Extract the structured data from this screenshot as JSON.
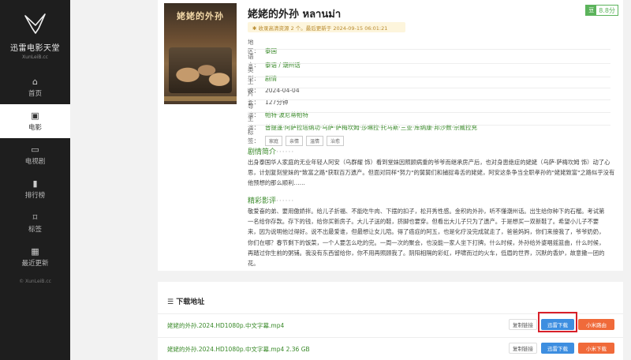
{
  "sidebar": {
    "logo_name": "迅雷电影天堂",
    "logo_url": "XunLeiB.cc",
    "items": [
      {
        "icon": "home-icon",
        "glyph": "⌂",
        "label": "首页"
      },
      {
        "icon": "film-icon",
        "glyph": "▣",
        "label": "电影",
        "active": true
      },
      {
        "icon": "tv-icon",
        "glyph": "▭",
        "label": "电视剧"
      },
      {
        "icon": "bar-chart-icon",
        "glyph": "▮",
        "label": "排行榜"
      },
      {
        "icon": "bookmark-icon",
        "glyph": "⌑",
        "label": "标签"
      },
      {
        "icon": "calendar-icon",
        "glyph": "▦",
        "label": "最近更新"
      }
    ],
    "copyright": "© XunLeiB.cc"
  },
  "movie": {
    "title": "姥姥的外孙 หลานม่า",
    "score": "8.8分",
    "score_icon": "豆",
    "notice": "✱ 收录高清资源 2 个。最后更新于 2024-09-15 06:01:21",
    "poster_title": "姥姥的外孙",
    "region_label": "地区：",
    "region": "泰国",
    "language_label": "语言：",
    "language": "泰语 / 潮州话",
    "genre_label": "类型：",
    "genre": "剧情",
    "release_label": "上映：",
    "release": "2024-04-04",
    "runtime_label": "片长：",
    "runtime": "127分钟",
    "director_label": "导演：",
    "director": "帕特·波尼蒂帕特",
    "cast_label": "主演：",
    "cast": "普提蓬·阿萨拉塔纳功·乌萨·萨梅坎姆·莎琳拉·托马斯·三亚·库纳康·邦沙数·宗威拉充",
    "tags_label": "标签：",
    "tags": [
      "家庭",
      "亲情",
      "温情",
      "治愈"
    ]
  },
  "synopsis": {
    "title": "剧情简介",
    "dots": "······",
    "lines": [
      "出身泰国华人家庭的无业年轻人阿安（乌群耀 饰）看到堂妹因照顾病重的爷爷而继承房产后，也对身患绝症的姥姥（乌萨·萨梅坎姆 饰）动了心",
      "思，计划复刻堂妹的\"致富之路\"获取百万遗产。但面对同样\"努力\"的舅舅们和捕捉毒舌的姥姥，阿安这条争当全职孝孙的\"姥姥致富\"之路似乎没有",
      "他预想的那么顺利……"
    ]
  },
  "review": {
    "title": "精彩影评",
    "dots": "······",
    "lines": [
      "敬爱奋的弟、要用傲娇拌。给儿子折福、不能吃牛肉、下摆的扣子，松开秀性感。金积的外孙，听不懂潮州话。出生给你种下的石榴。考试第",
      "一名给你存款。存下的钱，给你买新房子。大儿子送的鞋，挤脚也要穿。但看出大儿子只为了遗产。于是想买一双新鞋了。希望小儿子不要",
      "来，因为说明他过得好。说不出最爱谁，但最想让女儿陪。得了癌症的阿五，也是化疗没完成就走了，爸爸妈妈，你们来接我了，爷爷奶奶，",
      "你们在哪？春节剩下的饭菜，一个人要怎么吃的完。一周一次的聚会，也没能一家人坐下打牌。什么时候，外孙给外婆唱摇篮曲，什么时候，",
      "再踏过你生前的粥铺。我没有东西留给你，你不用再照顾我了。阴阳相隔的彩虹，呼啸而过的火车，低眉的世界，沉默的香炉，故意撒一团的",
      "花。"
    ]
  },
  "downloads": {
    "title": "下载地址",
    "title_icon": "list-icon",
    "rows": [
      {
        "name": "姥姥的外孙.2024.HD1080p.中文字幕.mp4",
        "copy": "复制链接",
        "thunder": "迅雷下载",
        "mi": "小米路由"
      },
      {
        "name": "姥姥的外孙.2024.HD1080p.中文字幕.mp4   2.36 GB",
        "copy": "复制链接",
        "thunder": "迅雷下载",
        "mi": "小米下载"
      }
    ]
  },
  "colors": {
    "accent": "#3a8a2a",
    "sidebar": "#1e1e1e",
    "thunder": "#3d8ee0",
    "mi": "#f06a3a",
    "highlight": "#d8202a"
  }
}
